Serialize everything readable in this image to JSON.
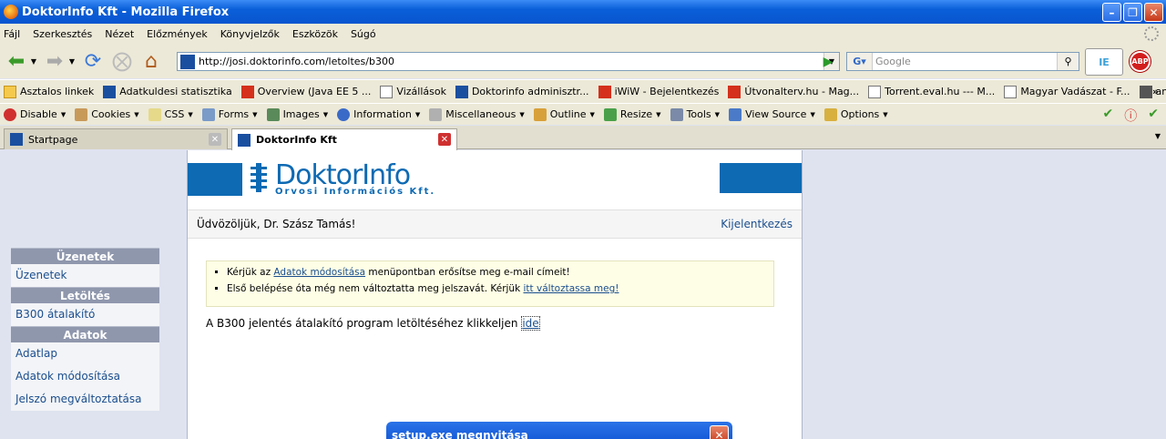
{
  "window": {
    "title": "DoktorInfo Kft - Mozilla Firefox"
  },
  "menu": [
    "Fájl",
    "Szerkesztés",
    "Nézet",
    "Előzmények",
    "Könyvjelzők",
    "Eszközök",
    "Súgó"
  ],
  "nav": {
    "url": "http://josi.doktorinfo.com/letoltes/b300",
    "search_placeholder": "Google"
  },
  "bookmarks": [
    {
      "label": "Asztalos linkek",
      "icon": "folder-icon"
    },
    {
      "label": "Adatkuldesi statisztika",
      "icon": "doktorinfo-icon"
    },
    {
      "label": "Overview (Java EE 5 ...",
      "icon": "java-icon"
    },
    {
      "label": "Vizállások",
      "icon": "page-icon"
    },
    {
      "label": "Doktorinfo adminisztr...",
      "icon": "doktorinfo-icon"
    },
    {
      "label": "iWiW - Bejelentkezés",
      "icon": "iwiw-icon"
    },
    {
      "label": "Útvonalterv.hu - Mag...",
      "icon": "route-icon"
    },
    {
      "label": "Torrent.eval.hu --- M...",
      "icon": "page-icon"
    },
    {
      "label": "Magyar Vadászat - F...",
      "icon": "page-icon"
    },
    {
      "label": "ami",
      "icon": "music-icon"
    }
  ],
  "devtoolbar": [
    "Disable",
    "Cookies",
    "CSS",
    "Forms",
    "Images",
    "Information",
    "Miscellaneous",
    "Outline",
    "Resize",
    "Tools",
    "View Source",
    "Options"
  ],
  "tabs": [
    {
      "label": "Startpage"
    },
    {
      "label": "DoktorInfo Kft"
    }
  ],
  "logo": {
    "title": "DoktorInfo",
    "subtitle": "Orvosi Információs Kft."
  },
  "header": {
    "welcome": "Üdvözöljük, Dr. Szász Tamás!",
    "logout": "Kijelentkezés"
  },
  "sidebar": {
    "sections": [
      {
        "title": "Üzenetek",
        "items": [
          "Üzenetek"
        ]
      },
      {
        "title": "Letöltés",
        "items": [
          "B300 átalakító"
        ]
      },
      {
        "title": "Adatok",
        "items": [
          "Adatlap",
          "Adatok módosítása",
          "Jelszó megváltoztatása"
        ]
      }
    ]
  },
  "notice": {
    "line1_pre": "Kérjük az ",
    "line1_link": "Adatok módosítása",
    "line1_post": " menüpontban erősítse meg e-mail címeit!",
    "line2_pre": "Első belépése óta még nem változtatta meg jelszavát. Kérjük ",
    "line2_link": "itt változtassa meg!"
  },
  "download": {
    "text": "A B300 jelentés átalakító program letöltéséhez klikkeljen ",
    "link": "ide"
  },
  "dialog": {
    "title": "setup.exe megnyitása"
  }
}
